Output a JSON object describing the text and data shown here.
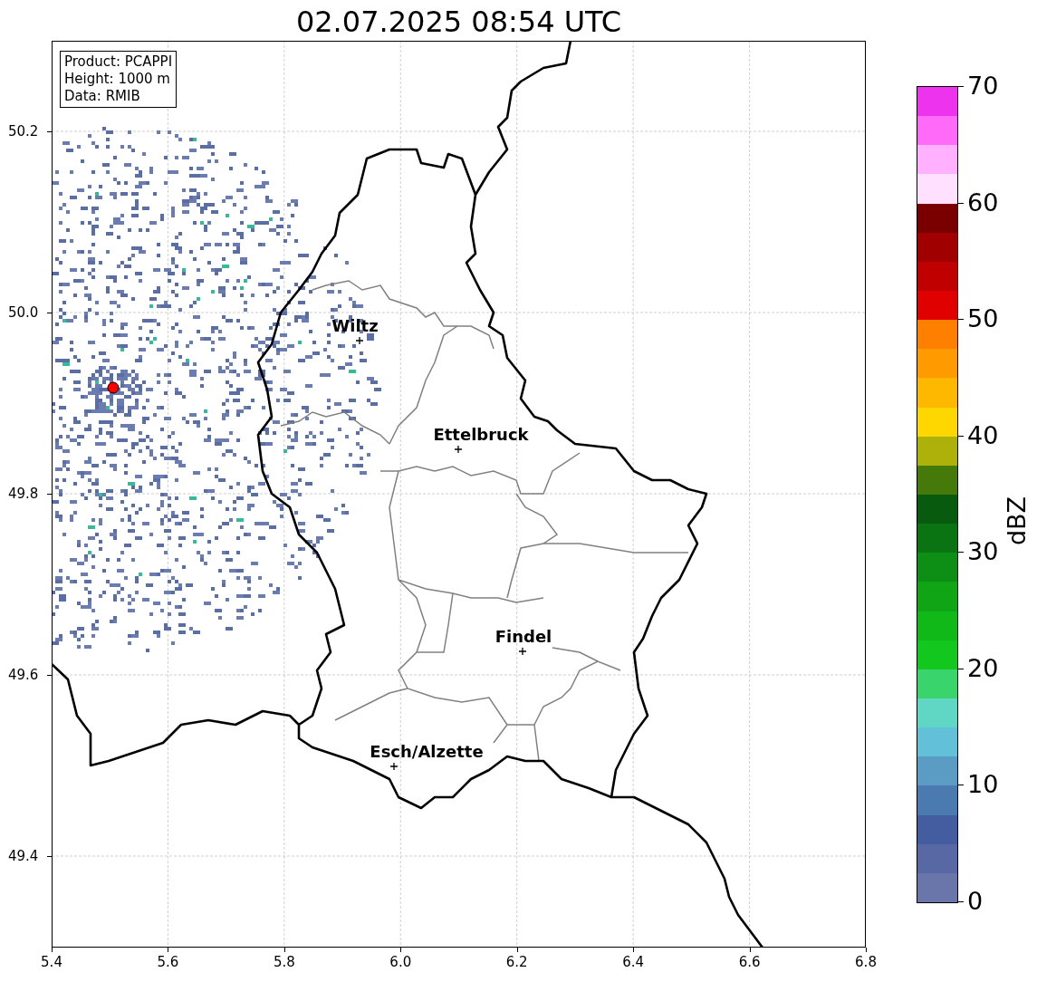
{
  "title": "02.07.2025 08:54 UTC",
  "info_box": [
    "Product: PCAPPI",
    "Height: 1000 m",
    "Data: RMIB"
  ],
  "map": {
    "x_ticks": [
      "5.4",
      "5.6",
      "5.8",
      "6.0",
      "6.2",
      "6.4",
      "6.6",
      "6.8"
    ],
    "y_ticks": [
      "50.2",
      "50.0",
      "49.8",
      "49.6",
      "49.4"
    ],
    "cities": [
      {
        "name": "Wiltz"
      },
      {
        "name": "Ettelbruck"
      },
      {
        "name": "Findel"
      },
      {
        "name": "Esch/Alzette"
      }
    ]
  },
  "colorbar": {
    "label": "dBZ",
    "ticks": [
      "70",
      "60",
      "50",
      "40",
      "30",
      "20",
      "10",
      "0"
    ],
    "bins": [
      {
        "color": "#ee33ee"
      },
      {
        "color": "#ff6af8"
      },
      {
        "color": "#ffb0ff"
      },
      {
        "color": "#ffe0ff"
      },
      {
        "color": "#7a0000"
      },
      {
        "color": "#a00000"
      },
      {
        "color": "#c00000"
      },
      {
        "color": "#e10000"
      },
      {
        "color": "#ff7f00"
      },
      {
        "color": "#ff9a00"
      },
      {
        "color": "#ffb800"
      },
      {
        "color": "#ffd700"
      },
      {
        "color": "#aeb10a"
      },
      {
        "color": "#457a0a"
      },
      {
        "color": "#075a0e"
      },
      {
        "color": "#0a7412"
      },
      {
        "color": "#0d8e14"
      },
      {
        "color": "#0fa514"
      },
      {
        "color": "#10b818"
      },
      {
        "color": "#12c81e"
      },
      {
        "color": "#3ad46c"
      },
      {
        "color": "#60d6c4"
      },
      {
        "color": "#62c0d8"
      },
      {
        "color": "#5a9cc4"
      },
      {
        "color": "#4a7ab0"
      },
      {
        "color": "#435da0"
      },
      {
        "color": "#5868a4"
      },
      {
        "color": "#6a76aa"
      }
    ]
  }
}
